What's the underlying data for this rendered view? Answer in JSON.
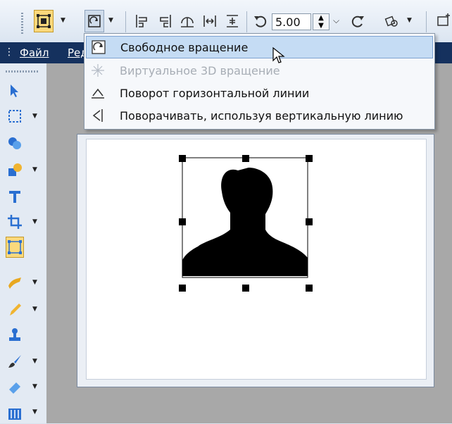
{
  "toolbar": {
    "rotate_value": "5.00",
    "items": [
      "select-tool",
      "rotate-mode",
      "align-left",
      "align-right",
      "flip-horizontal",
      "align-center",
      "align-v",
      "rotate-ccw",
      "rotate-cw",
      "transform-options"
    ]
  },
  "menubar": {
    "file": "Файл",
    "edit": "Ред"
  },
  "rotate_menu": {
    "items": [
      {
        "label": "Свободное вращение",
        "state": "highlighted",
        "icon": "free-rotate-icon"
      },
      {
        "label": "Виртуальное 3D вращение",
        "state": "disabled",
        "icon": "rotate-3d-icon"
      },
      {
        "label": "Поворот горизонтальной линии",
        "state": "normal",
        "icon": "horizontal-line-rotate-icon"
      },
      {
        "label": "Поворачивать, используя вертикальную линию",
        "state": "normal",
        "icon": "vertical-line-rotate-icon"
      }
    ]
  },
  "colors": {
    "menubar": "#15315e",
    "highlight": "#c5dcf4",
    "active_tool": "#fbd97c",
    "canvas_bg": "#a8a8a8"
  }
}
